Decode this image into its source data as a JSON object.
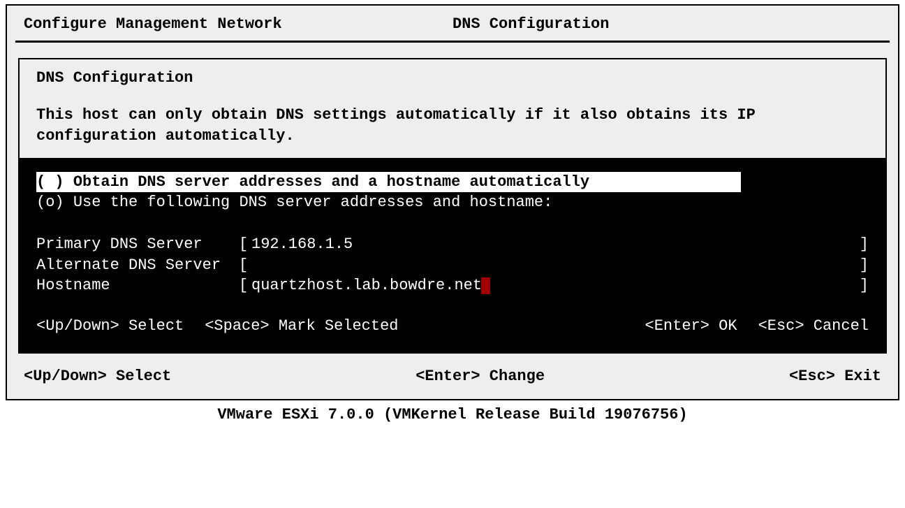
{
  "header": {
    "breadcrumb": "Configure Management Network",
    "title": "DNS Configuration"
  },
  "dialog": {
    "title": "DNS Configuration",
    "description": "This host can only obtain DNS settings automatically if it also obtains its IP configuration automatically.",
    "options": {
      "auto": {
        "mark": "( )",
        "label": "Obtain DNS server addresses and a hostname automatically",
        "selected": true
      },
      "manual": {
        "mark": "(o)",
        "label": "Use the following DNS server addresses and hostname:",
        "selected": false
      }
    },
    "fields": {
      "primary": {
        "label": "Primary DNS Server",
        "value": "192.168.1.5"
      },
      "alternate": {
        "label": "Alternate DNS Server",
        "value": ""
      },
      "hostname": {
        "label": "Hostname",
        "value": "quartzhost.lab.bowdre.net"
      }
    },
    "help": {
      "updown": "<Up/Down> Select",
      "space": "<Space> Mark Selected",
      "enter": "<Enter> OK",
      "esc": "<Esc> Cancel"
    }
  },
  "footer": {
    "updown": "<Up/Down> Select",
    "enter": "<Enter> Change",
    "esc": "<Esc> Exit"
  },
  "version": "VMware ESXi 7.0.0 (VMKernel Release Build 19076756)"
}
